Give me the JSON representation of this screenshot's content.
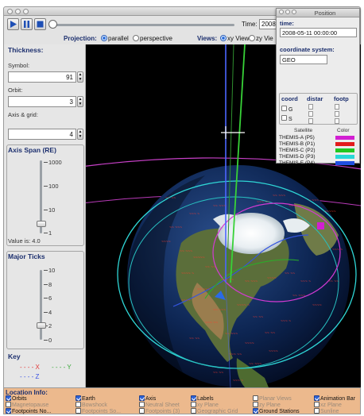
{
  "toolbar": {
    "play_icon": "play-icon",
    "pause_icon": "pause-icon",
    "stop_icon": "stop-icon",
    "time_label": "Time:",
    "time_value": "2008-0"
  },
  "projection_row": {
    "projection_label": "Projection:",
    "parallel": "parallel",
    "perspective": "perspective",
    "views_label": "Views:",
    "xy_view": "xy View",
    "zy_view": "zy Vie"
  },
  "left_panel": {
    "thickness_title": "Thickness:",
    "symbol_label": "Symbol:",
    "symbol_value": "91",
    "orbit_label": "Orbit:",
    "orbit_value": "3",
    "axis_grid_label": "Axis & grid:",
    "axis_grid_value": "4",
    "axis_span_title": "Axis Span (RE)",
    "axis_span_ticks": [
      "1000",
      "100",
      "10",
      "1"
    ],
    "axis_span_value_text": "Value is: 4.0",
    "major_ticks_title": "Major Ticks",
    "major_ticks_ticks": [
      "10",
      "8",
      "6",
      "4",
      "2",
      "0"
    ],
    "major_ticks_value": 0.2,
    "key_title": "Key",
    "key_x": "X",
    "key_y": "Y",
    "key_z": "Z"
  },
  "position_window": {
    "title": "Position",
    "time_label": "time:",
    "time_value": "2008-05-11 00:00:00",
    "coord_system_label": "coordinate system:",
    "coord_system_value": "GEO",
    "col_coord": "coord",
    "col_distance": "distar",
    "col_footprint": "footp",
    "row1": "G",
    "row2": "S",
    "satellite_header": "Satellite",
    "color_header": "Color",
    "satellites": [
      {
        "name": "THEMIS-A (P5)",
        "color": "#d21fd2"
      },
      {
        "name": "THEMIS-B (P1)",
        "color": "#e21b1b"
      },
      {
        "name": "THEMIS-C (P2)",
        "color": "#22c722"
      },
      {
        "name": "THEMIS-D (P3)",
        "color": "#27d8d8"
      },
      {
        "name": "THEMIS-E (P4)",
        "color": "#1f4fe0"
      }
    ]
  },
  "location_info": {
    "title": "Location Info:",
    "options": [
      {
        "label": "Orbits",
        "checked": true
      },
      {
        "label": "Magnetopause",
        "checked": false
      },
      {
        "label": "Footpoints No...",
        "checked": true
      },
      {
        "label": "Earth",
        "checked": true
      },
      {
        "label": "Bowshock",
        "checked": false
      },
      {
        "label": "Footpoints So...",
        "checked": false
      },
      {
        "label": "Axis",
        "checked": true
      },
      {
        "label": "Neutral Sheet",
        "checked": false
      },
      {
        "label": "Footpoints (3)",
        "checked": false
      },
      {
        "label": "Labels",
        "checked": true
      },
      {
        "label": "xy Plane",
        "checked": false
      },
      {
        "label": "Geographic Grid",
        "checked": false
      },
      {
        "label": "Planar Views",
        "checked": false
      },
      {
        "label": "zy Plane",
        "checked": false
      },
      {
        "label": "Ground Stations",
        "checked": true
      },
      {
        "label": "Animation Bar",
        "checked": true
      },
      {
        "label": "xz Plane",
        "checked": false
      },
      {
        "label": "Sunline",
        "checked": false
      }
    ]
  },
  "colors": {
    "x_axis": "#e23a3a",
    "y_axis": "#3aa83a",
    "z_axis": "#3a52e2"
  }
}
